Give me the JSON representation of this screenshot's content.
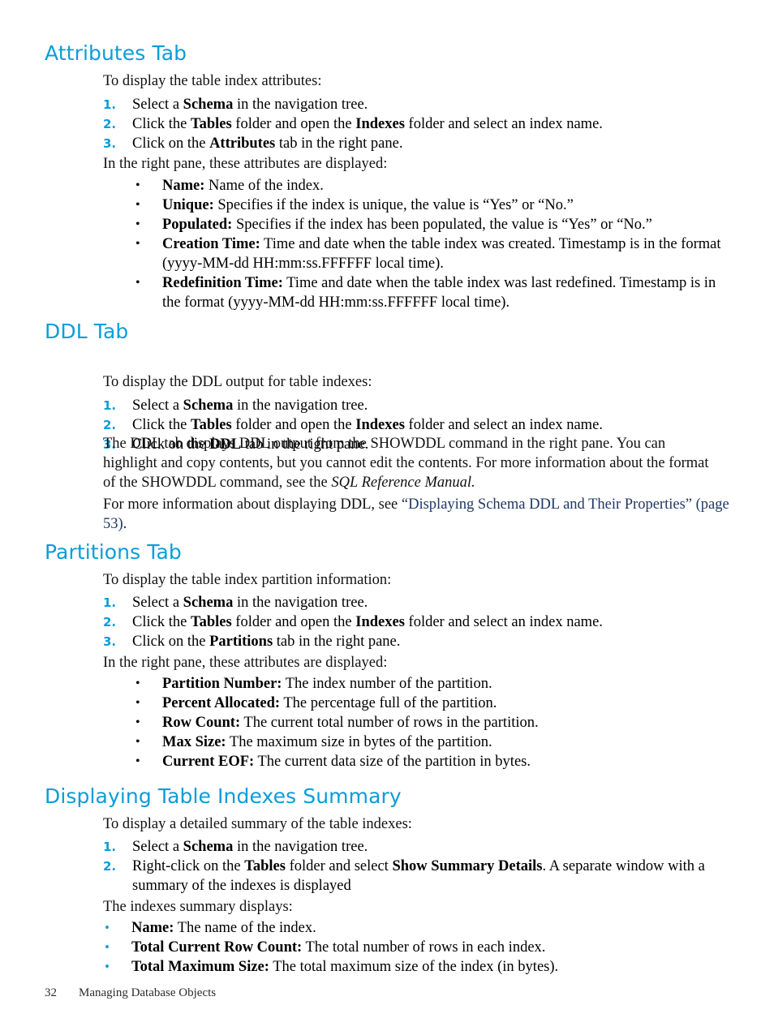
{
  "page": {
    "number": "32",
    "footer_title": "Managing Database Objects"
  },
  "sections": [
    {
      "id": "attributes-tab",
      "heading": "Attributes Tab",
      "intro": "To display the table index attributes:",
      "steps": [
        {
          "marker": "1.",
          "pre": "Select a ",
          "bold": "Schema",
          "post": " in the navigation tree."
        },
        {
          "marker": "2.",
          "pre": "Click the ",
          "bold": "Tables",
          "mid": " folder and open the ",
          "bold2": "Indexes",
          "post": " folder and select an index name."
        },
        {
          "marker": "3.",
          "pre": "Click on the ",
          "bold": "Attributes",
          "post": " tab in the right pane."
        }
      ],
      "sub_intro": "In the right pane, these attributes are displayed:",
      "bullets": [
        {
          "term": "Name:",
          "desc": " Name of the index."
        },
        {
          "term": "Unique:",
          "desc": " Specifies if the index is unique, the value is “Yes” or “No.”"
        },
        {
          "term": "Populated:",
          "desc": " Specifies if the index has been populated, the value is “Yes” or “No.”"
        },
        {
          "term": "Creation Time:",
          "desc": " Time and date when the table index was created. Timestamp is in the format (yyyy-MM-dd HH:mm:ss.FFFFFF local time)."
        },
        {
          "term": "Redefinition Time:",
          "desc": " Time and date when the table index was last redefined. Timestamp is in the format (yyyy-MM-dd HH:mm:ss.FFFFFF local time)."
        }
      ]
    },
    {
      "id": "ddl-tab",
      "heading": "DDL Tab",
      "intro": "To display the DDL output for table indexes:",
      "steps": [
        {
          "marker": "1.",
          "pre": "Select a ",
          "bold": "Schema",
          "post": " in the navigation tree."
        },
        {
          "marker": "2.",
          "pre": "Click the ",
          "bold": "Tables",
          "mid": " folder and open the ",
          "bold2": "Indexes",
          "post": " folder and select an index name."
        },
        {
          "marker": "3.",
          "pre": "Click on the ",
          "bold": "DDL",
          "post": " tab in the right pane."
        }
      ],
      "body_pre": "The DDL tab displays DDL output from the SHOWDDL command in the right pane. You can highlight and copy contents, but you cannot edit the contents. For more information about the format of the SHOWDDL command, see the ",
      "body_italic": "SQL Reference Manual.",
      "xref_pre": "For more information about displaying DDL, see ",
      "xref_link": "“Displaying Schema DDL and Their Properties” (page 53)",
      "xref_post": "."
    },
    {
      "id": "partitions-tab",
      "heading": "Partitions Tab",
      "intro": "To display the table index partition information:",
      "steps": [
        {
          "marker": "1.",
          "pre": "Select a ",
          "bold": "Schema",
          "post": " in the navigation tree."
        },
        {
          "marker": "2.",
          "pre": "Click the ",
          "bold": "Tables",
          "mid": " folder and open the ",
          "bold2": "Indexes",
          "post": " folder and select an index name."
        },
        {
          "marker": "3.",
          "pre": "Click on the ",
          "bold": "Partitions",
          "post": " tab in the right pane."
        }
      ],
      "sub_intro": "In the right pane, these attributes are displayed:",
      "bullets": [
        {
          "term": "Partition Number:",
          "desc": " The index number of the partition."
        },
        {
          "term": "Percent Allocated:",
          "desc": " The percentage full of the partition."
        },
        {
          "term": "Row Count:",
          "desc": " The current total number of rows in the partition."
        },
        {
          "term": "Max Size:",
          "desc": " The maximum size in bytes of the partition."
        },
        {
          "term": "Current EOF:",
          "desc": " The current data size of the partition in bytes."
        }
      ]
    },
    {
      "id": "indexes-summary",
      "heading": "Displaying Table Indexes Summary",
      "intro": "To display a detailed summary of the table indexes:",
      "steps": [
        {
          "marker": "1.",
          "pre": "Select a ",
          "bold": "Schema",
          "post": " in the navigation tree."
        },
        {
          "marker": "2.",
          "pre": "Right-click on the ",
          "bold": "Tables",
          "mid": " folder and select ",
          "bold2": "Show Summary Details",
          "post": ". A separate window with a summary of the indexes is displayed"
        }
      ],
      "sub_intro": "The indexes summary displays:",
      "bullets": [
        {
          "term": "Name:",
          "desc": " The name of the index."
        },
        {
          "term": "Total Current Row Count:",
          "desc": " The total number of rows in each index."
        },
        {
          "term": "Total Maximum Size:",
          "desc": " The total maximum size of the index (in bytes)."
        }
      ]
    }
  ],
  "colors": {
    "heading": "#0b9dd9",
    "list_number": "#0b9dd9",
    "blue_bullet": "#1b9bd8",
    "cross_reference": "#1f3864",
    "body_text": "#111111"
  },
  "icons": {
    "bullet_glyph": "•"
  }
}
